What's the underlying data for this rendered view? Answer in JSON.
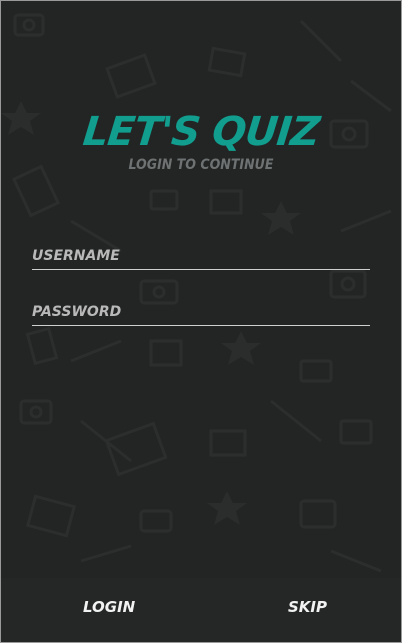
{
  "header": {
    "title": "LET'S QUIZ",
    "subtitle": "LOGIN TO CONTINUE"
  },
  "form": {
    "username_placeholder": "USERNAME",
    "username_value": "",
    "password_placeholder": "PASSWORD",
    "password_value": ""
  },
  "actions": {
    "login_label": "LOGIN",
    "skip_label": "SKIP"
  },
  "colors": {
    "background": "#232424",
    "accent": "#119e8f",
    "subtitle": "#6e7272",
    "bottom_bar": "#252626"
  }
}
